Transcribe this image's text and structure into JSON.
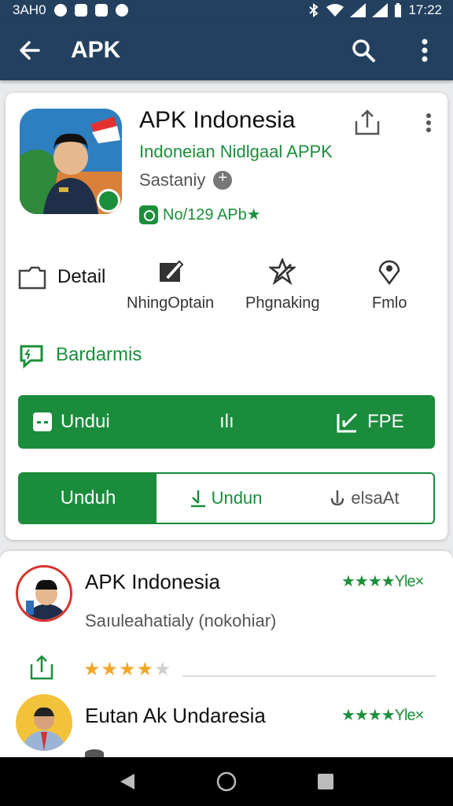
{
  "status_bar": {
    "left_text": "3AH0",
    "time": "17:22"
  },
  "app_bar": {
    "title": "APK"
  },
  "app": {
    "name": "APK Indonesia",
    "subtitle": "Indoneian Nidlgaal APPK",
    "developer": "Sastaniy",
    "rating_text": "No/129 APb★"
  },
  "info": {
    "detail_label": "Detail",
    "items": [
      {
        "label": "NhingOptain"
      },
      {
        "label": "Phgnaking"
      },
      {
        "label": "Fmlo"
      }
    ],
    "permissions_label": "Bardarmis"
  },
  "download_bar": {
    "seg1": "Undui",
    "seg2": "ılı",
    "seg3": "FPE"
  },
  "split_bar": {
    "left": "Unduh",
    "mid": "Undun",
    "right": "elsaAt"
  },
  "list": [
    {
      "title": "APK Indonesia",
      "rating_label": "★★★★Yle×",
      "description": "Saıuleahatialy (nokohiar)",
      "stars_filled": 4,
      "stars_total": 5,
      "stars_on": "★★★★",
      "stars_off": "★"
    },
    {
      "title": "Eutan Ak Undaresia",
      "rating_label": "★★★★Yle×"
    }
  ],
  "colors": {
    "header": "#24405f",
    "accent_green": "#1a8c3c",
    "star_orange": "#f2a629"
  },
  "icons": {
    "back": "arrow-left-icon",
    "search": "search-icon",
    "more": "more-vert-icon",
    "share": "share-icon"
  }
}
